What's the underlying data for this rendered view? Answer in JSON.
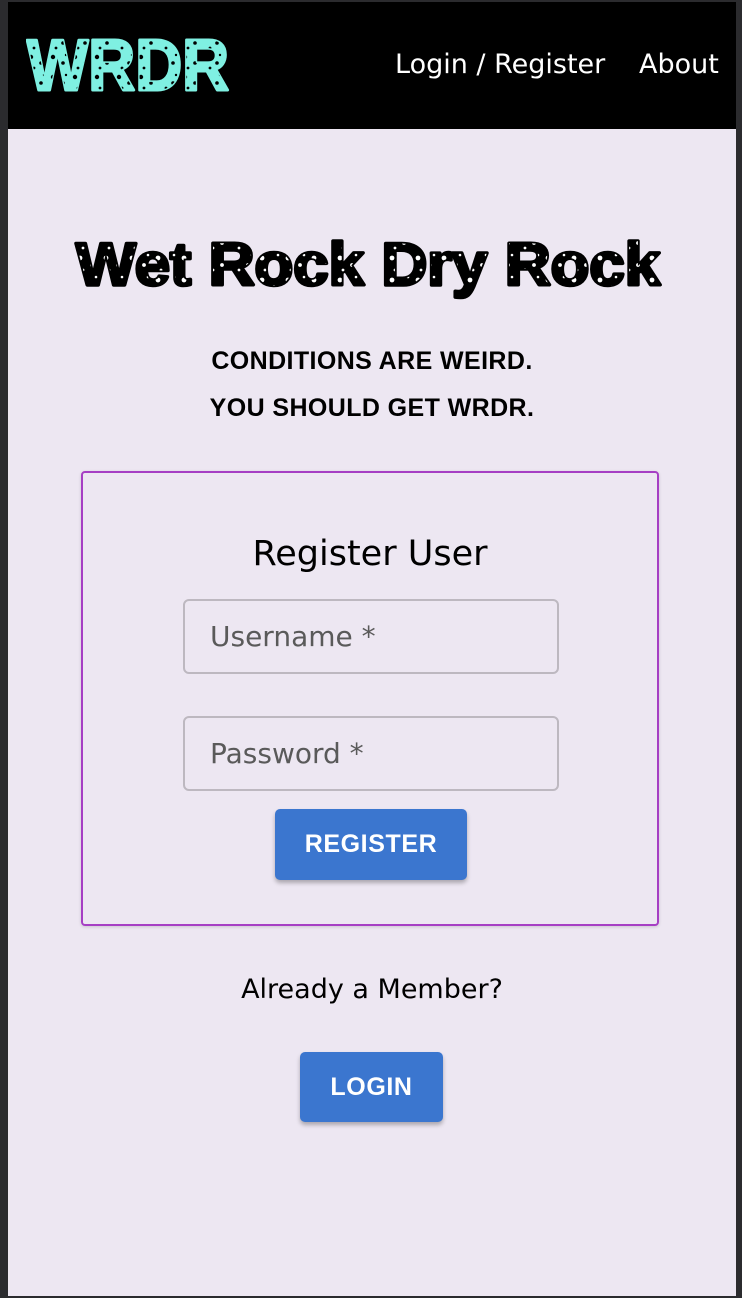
{
  "header": {
    "logo_text": "WRDR",
    "nav": [
      {
        "label": "Login / Register"
      },
      {
        "label": "About"
      }
    ]
  },
  "hero": {
    "title": "Wet Rock Dry Rock",
    "tagline_line1": "CONDITIONS ARE WEIRD.",
    "tagline_line2": "YOU SHOULD GET WRDR."
  },
  "register_form": {
    "title": "Register User",
    "username_placeholder": "Username *",
    "password_placeholder": "Password *",
    "submit_label": "REGISTER"
  },
  "login_prompt": {
    "text": "Already a Member?",
    "button_label": "LOGIN"
  },
  "colors": {
    "navbar_bg": "#000000",
    "logo_fill": "#7ff0e2",
    "page_bg": "#ede7f2",
    "card_border": "#a63fc4",
    "button_bg": "#3b76cf"
  }
}
